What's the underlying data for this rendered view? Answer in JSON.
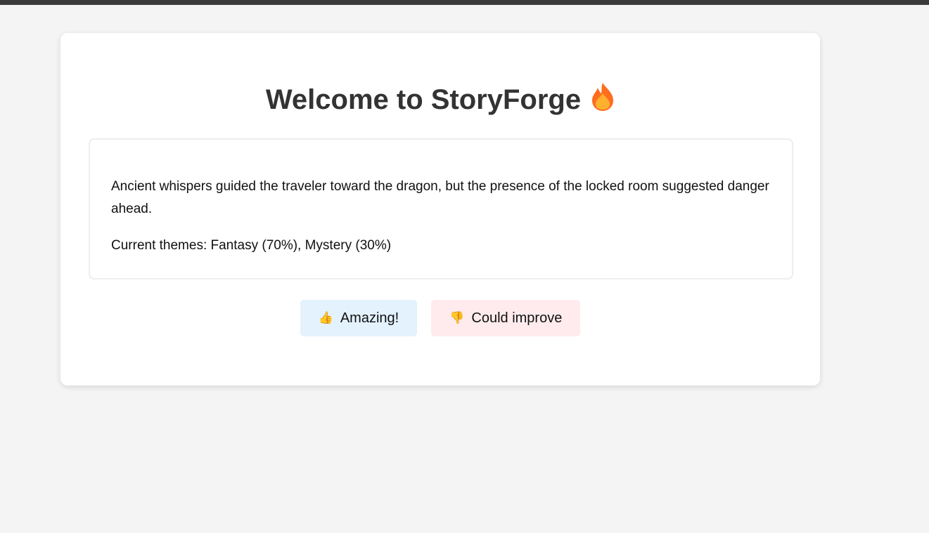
{
  "header": {
    "title": "Welcome to StoryForge",
    "title_icon": "fire-icon"
  },
  "story": {
    "text": "Ancient whispers guided the traveler toward the dragon, but the presence of the locked room suggested danger ahead.",
    "themes": "Current themes: Fantasy (70%), Mystery (30%)"
  },
  "feedback": {
    "positive_label": "Amazing!",
    "positive_icon": "thumbs-up-icon",
    "positive_color": "#e3f2fd",
    "negative_label": "Could improve",
    "negative_icon": "thumbs-down-icon",
    "negative_color": "#ffebee"
  }
}
